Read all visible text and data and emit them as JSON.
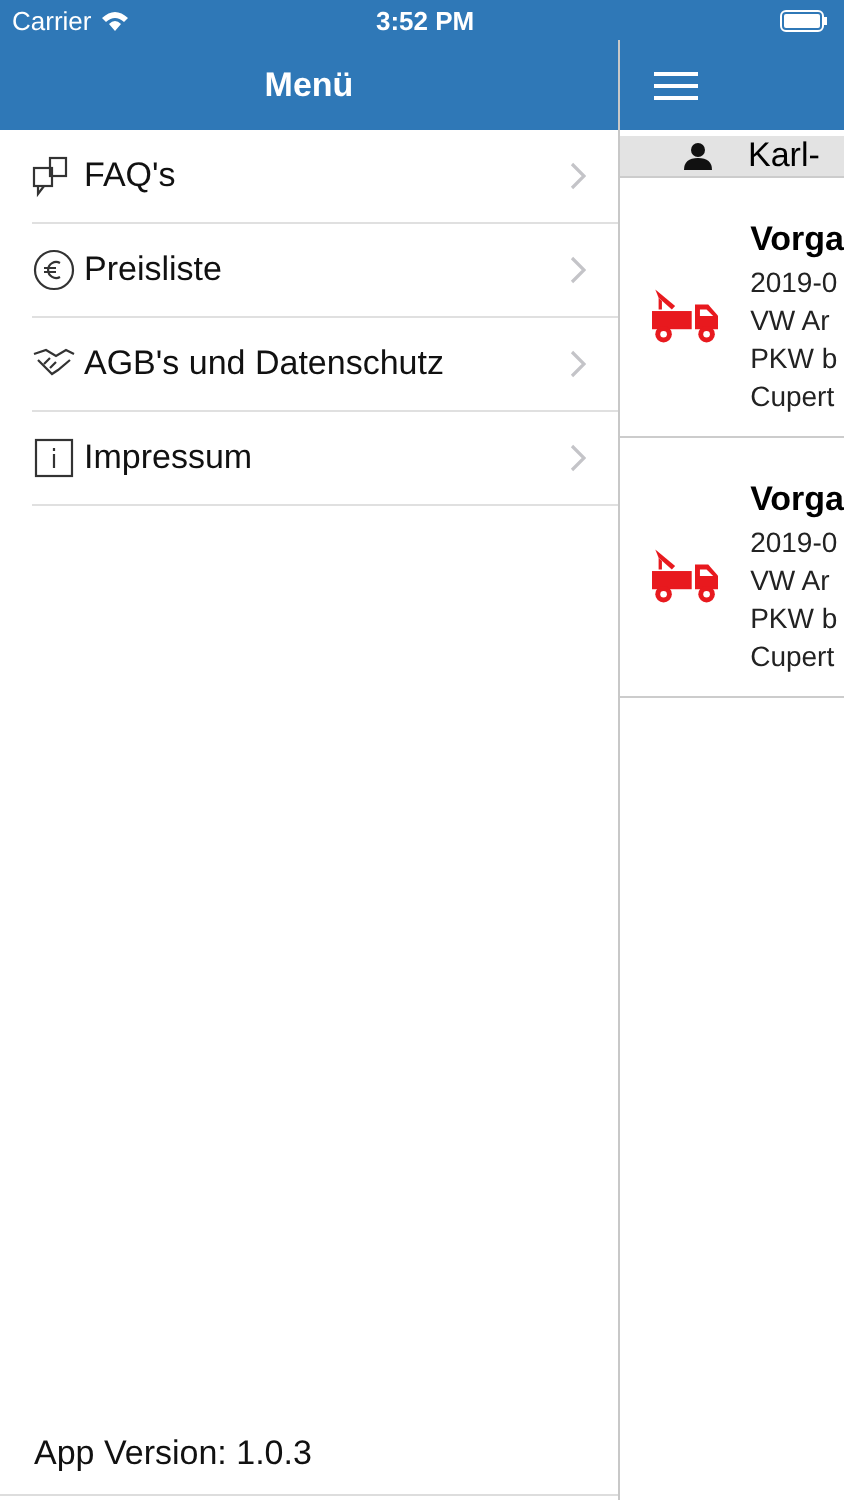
{
  "status_bar": {
    "carrier": "Carrier",
    "time": "3:52 PM"
  },
  "menu": {
    "title": "Menü",
    "items": [
      {
        "label": "FAQ's"
      },
      {
        "label": "Preisliste"
      },
      {
        "label": "AGB's und Datenschutz"
      },
      {
        "label": "Impressum"
      }
    ],
    "footer": "App Version: 1.0.3"
  },
  "main": {
    "user": "Karl-",
    "cases": [
      {
        "title": "Vorga",
        "date": "2019-0",
        "vehicle": "VW Ar",
        "type": "PKW b",
        "place": "Cupert"
      },
      {
        "title": "Vorga",
        "date": "2019-0",
        "vehicle": "VW Ar",
        "type": "PKW b",
        "place": "Cupert"
      }
    ]
  }
}
